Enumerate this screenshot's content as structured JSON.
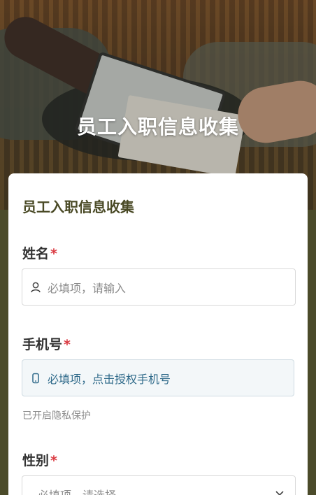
{
  "hero": {
    "title": "员工入职信息收集"
  },
  "form": {
    "title": "员工入职信息收集",
    "fields": [
      {
        "label": "姓名",
        "required_mark": "*",
        "placeholder": "必填项，请输入",
        "icon": "user-icon"
      },
      {
        "label": "手机号",
        "required_mark": "*",
        "placeholder": "必填项，点击授权手机号",
        "icon": "phone-icon",
        "hint": "已开启隐私保护"
      },
      {
        "label": "性别",
        "required_mark": "*",
        "placeholder": "必填项，请选择",
        "icon": "chevron-down-icon"
      }
    ]
  },
  "colors": {
    "background": "#4b4b2a",
    "title_text": "#4a4a26",
    "required": "#d9363e",
    "phone_text": "#2f6a8a"
  }
}
